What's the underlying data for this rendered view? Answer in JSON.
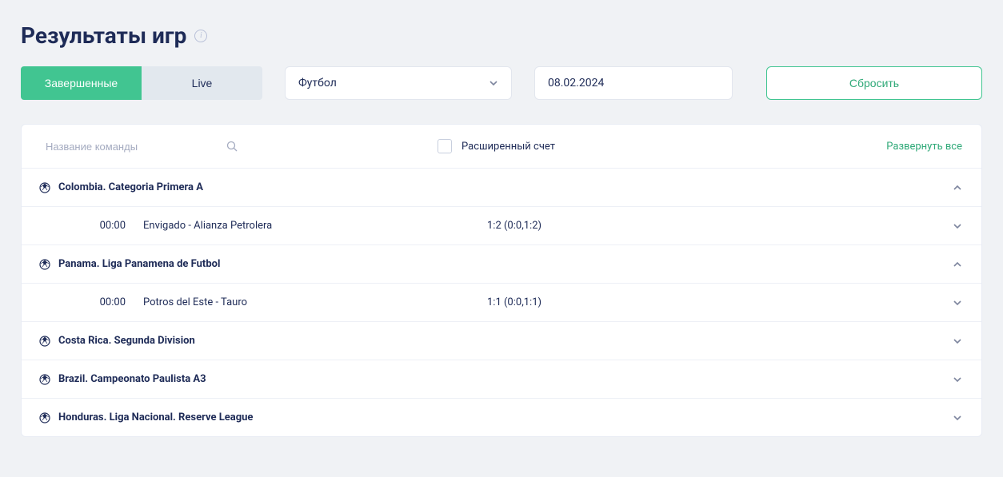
{
  "page": {
    "title": "Результаты игр"
  },
  "controls": {
    "tab_completed": "Завершенные",
    "tab_live": "Live",
    "sport_select": "Футбол",
    "date": "08.02.2024",
    "reset": "Сбросить"
  },
  "panel": {
    "search_placeholder": "Название команды",
    "extended_score_label": "Расширенный счет",
    "expand_all": "Развернуть все"
  },
  "leagues": [
    {
      "name": "Colombia. Categoria Primera A",
      "expanded": true,
      "matches": [
        {
          "time": "00:00",
          "teams": "Envigado - Alianza Petrolera",
          "score": "1:2 (0:0,1:2)"
        }
      ]
    },
    {
      "name": "Panama. Liga Panamena de Futbol",
      "expanded": true,
      "matches": [
        {
          "time": "00:00",
          "teams": "Potros del Este - Tauro",
          "score": "1:1 (0:0,1:1)"
        }
      ]
    },
    {
      "name": "Costa Rica. Segunda Division",
      "expanded": false,
      "matches": []
    },
    {
      "name": "Brazil. Campeonato Paulista A3",
      "expanded": false,
      "matches": []
    },
    {
      "name": "Honduras. Liga Nacional. Reserve League",
      "expanded": false,
      "matches": []
    }
  ]
}
